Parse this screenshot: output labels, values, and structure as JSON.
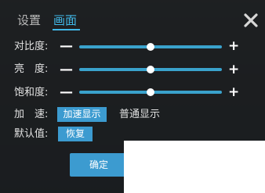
{
  "tabs": [
    {
      "label": "设置",
      "active": false
    },
    {
      "label": "画面",
      "active": true
    }
  ],
  "accent_color": "#41b8e8",
  "close_icon": "close-icon",
  "sliders": [
    {
      "label": "对比度:",
      "minus": "—",
      "plus": "+",
      "value": 0.5
    },
    {
      "label": "亮　度:",
      "minus": "—",
      "plus": "+",
      "value": 0.5
    },
    {
      "label": "饱和度:",
      "minus": "—",
      "plus": "+",
      "value": 0.5
    }
  ],
  "acceleration": {
    "label": "加　速:",
    "option_hw": "加速显示",
    "option_normal": "普通显示",
    "selected": "加速显示"
  },
  "default": {
    "label": "默认值:",
    "reset": "恢复"
  },
  "confirm_label": "确定"
}
